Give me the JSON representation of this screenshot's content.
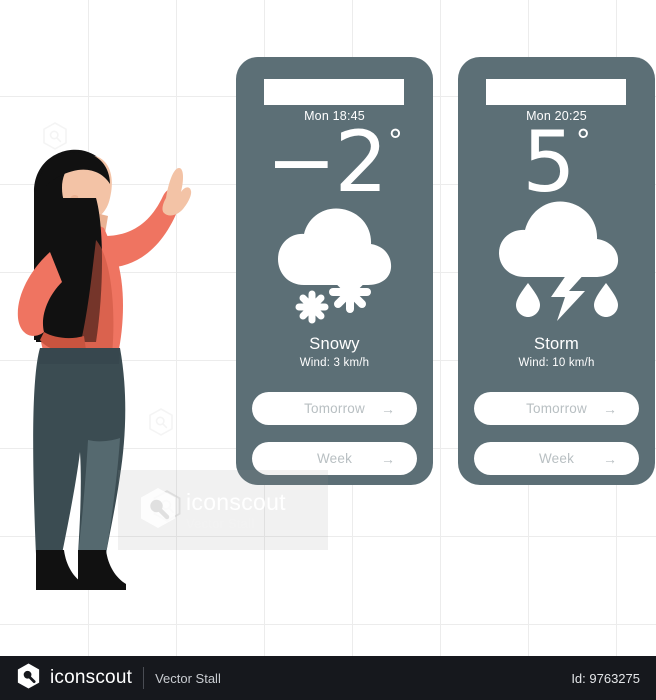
{
  "canvas": {
    "background": "#ffffff",
    "grid_color": "#ececec",
    "grid_spacing": 88
  },
  "watermark": {
    "name": "iconscout",
    "sub": "Vector Stall",
    "logo_icon": "iconscout-hex-logo-icon"
  },
  "character": {
    "name": "woman-pointing-illustration",
    "hair_color": "#111111",
    "skin_color": "#f3c3a6",
    "top_color": "#ef7461",
    "top_shadow_color": "#c9543f",
    "pants_color": "#3b4c52",
    "pants_shadow_color": "#5b6f74",
    "shoe_color": "#111111"
  },
  "cards": [
    {
      "id": "weather-card-snowy",
      "time": "Mon 18:45",
      "temperature": "−2",
      "degree": "°",
      "condition": "Snowy",
      "wind": "Wind: 3 km/h",
      "icon": "cloud-snow-icon",
      "buttons": [
        {
          "label": "Tomorrow",
          "arrow": "→",
          "name": "tomorrow-button"
        },
        {
          "label": "Week",
          "arrow": "→",
          "name": "week-button"
        }
      ]
    },
    {
      "id": "weather-card-storm",
      "time": "Mon 20:25",
      "temperature": "5",
      "degree": "°",
      "condition": "Storm",
      "wind": "Wind: 10 km/h",
      "icon": "cloud-lightning-rain-icon",
      "buttons": [
        {
          "label": "Tomorrow",
          "arrow": "→",
          "name": "tomorrow-button"
        },
        {
          "label": "Week",
          "arrow": "→",
          "name": "week-button"
        }
      ]
    }
  ],
  "colors": {
    "card_bg": "#5c6f76",
    "card_text": "#ffffff",
    "pill_bg": "#ffffff",
    "pill_text": "#b8bfc2",
    "footer_bg": "#16181d",
    "accent_coral": "#ef7461"
  },
  "footer": {
    "brand": "iconscout",
    "author": "Vector Stall",
    "id": "Id: 9763275",
    "logo_icon": "iconscout-hex-logo-icon"
  }
}
